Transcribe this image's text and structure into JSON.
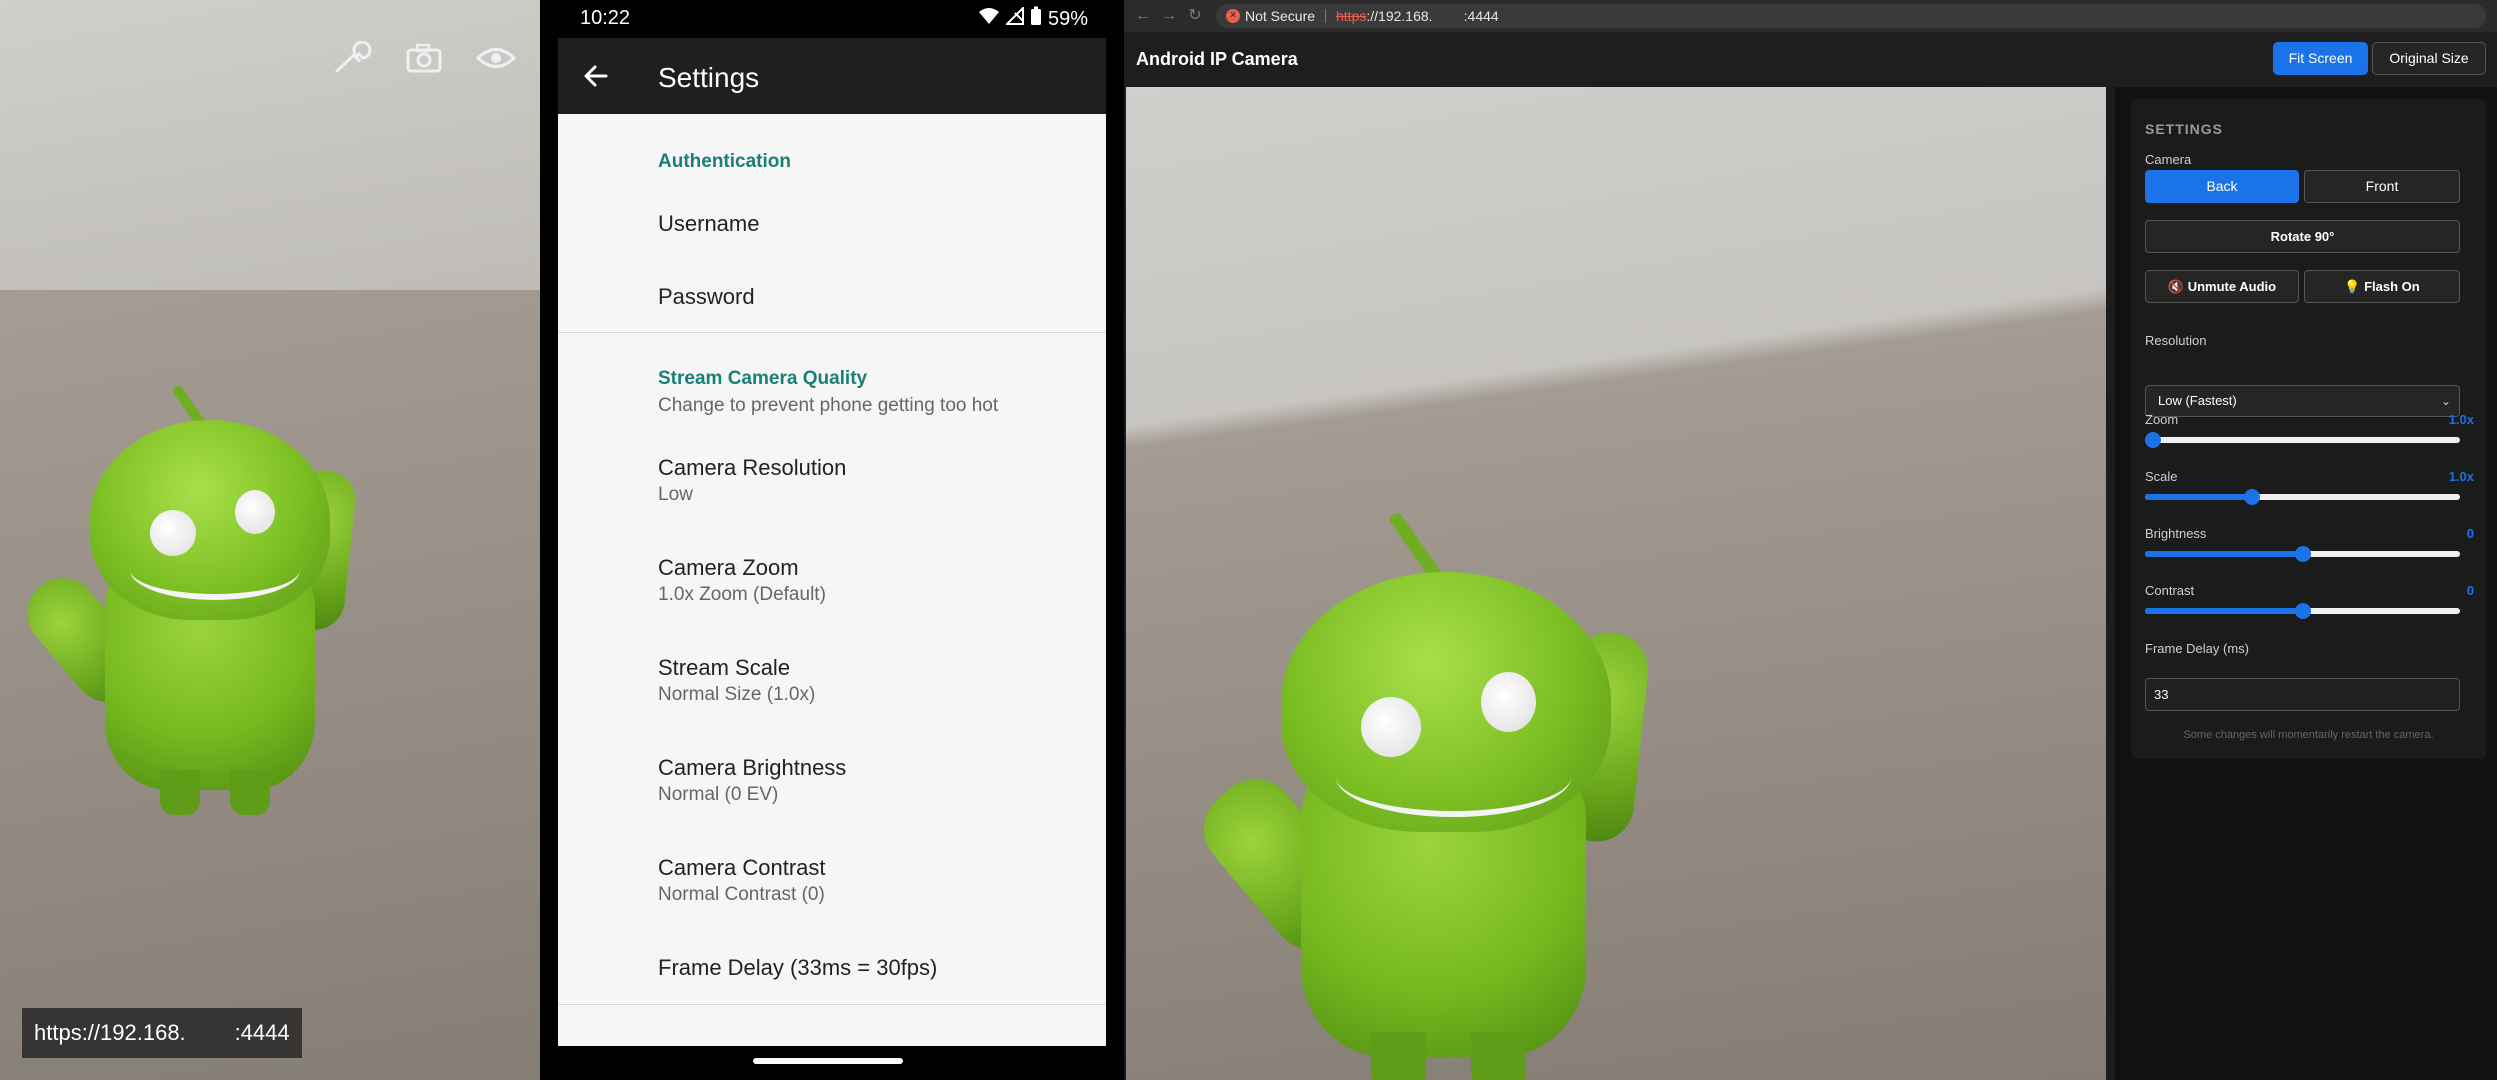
{
  "camera_overlay": {
    "icons": [
      "wrench-icon",
      "camera-icon",
      "eye-icon"
    ],
    "url": "https://192.168.        :4444"
  },
  "phone": {
    "status": {
      "time": "10:22",
      "battery": "59%"
    },
    "app_bar": {
      "title": "Settings"
    },
    "sections": [
      {
        "header": "Authentication",
        "items": [
          {
            "title": "Username"
          },
          {
            "title": "Password"
          }
        ]
      },
      {
        "header": "Stream Camera Quality",
        "subtitle": "Change to prevent phone getting too hot",
        "items": [
          {
            "title": "Camera Resolution",
            "summary": "Low"
          },
          {
            "title": "Camera Zoom",
            "summary": "1.0x Zoom (Default)"
          },
          {
            "title": "Stream Scale",
            "summary": "Normal Size (1.0x)"
          },
          {
            "title": "Camera Brightness",
            "summary": "Normal (0 EV)"
          },
          {
            "title": "Camera Contrast",
            "summary": "Normal Contrast (0)"
          },
          {
            "title": "Frame Delay (33ms = 30fps)"
          }
        ]
      }
    ]
  },
  "browser": {
    "security_label": "Not Secure",
    "url_scheme": "https",
    "url_rest": "://192.168.        :4444",
    "page_title": "Android IP Camera",
    "buttons": {
      "fit": "Fit Screen",
      "original": "Original Size"
    },
    "settings": {
      "heading": "SETTINGS",
      "camera_label": "Camera",
      "camera_back": "Back",
      "camera_front": "Front",
      "camera_selected": "Back",
      "rotate": "Rotate 90°",
      "audio": "🔇 Unmute Audio",
      "flash": "💡 Flash On",
      "resolution_label": "Resolution",
      "resolution_value": "Low (Fastest)",
      "sliders": [
        {
          "label": "Zoom",
          "display": "1.0x",
          "value": 0.0
        },
        {
          "label": "Scale",
          "display": "1.0x",
          "value": 0.33
        },
        {
          "label": "Brightness",
          "display": "0",
          "value": 0.5
        },
        {
          "label": "Contrast",
          "display": "0",
          "value": 0.5
        }
      ],
      "frame_delay_label": "Frame Delay (ms)",
      "frame_delay_value": "33",
      "footer_note": "Some changes will momentarily restart the camera."
    }
  },
  "colors": {
    "accent": "#1a73e8",
    "section_teal": "#1a7f76",
    "warning": "#e8604c"
  }
}
